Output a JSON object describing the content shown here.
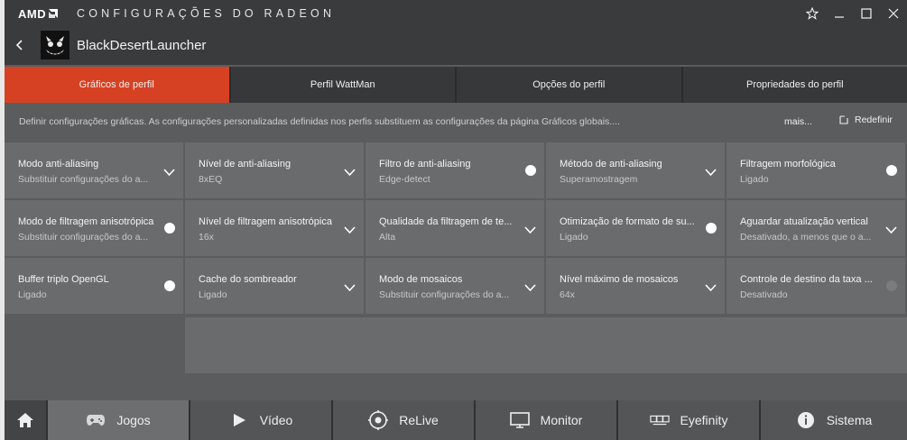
{
  "window": {
    "brand": "AMD",
    "title": "CONFIGURAÇÕES DO RADEON",
    "controls": [
      "star-icon",
      "minimize-icon",
      "maximize-icon",
      "close-icon"
    ]
  },
  "profile": {
    "back_icon": "back-chevron-icon",
    "game_name": "BlackDesertLauncher"
  },
  "tabs": [
    {
      "label": "Gráficos de perfil",
      "active": true
    },
    {
      "label": "Perfil WattMan",
      "active": false
    },
    {
      "label": "Opções do perfil",
      "active": false
    },
    {
      "label": "Propriedades do perfil",
      "active": false
    }
  ],
  "description": {
    "text": "Definir configurações gráficas. As configurações personalizadas definidas nos perfis substituem as configurações da página Gráficos globais....",
    "more_label": "mais...",
    "reset_label": "Redefinir"
  },
  "settings": [
    {
      "label": "Modo anti-aliasing",
      "value": "Substituir configurações do a...",
      "control": "dropdown"
    },
    {
      "label": "Nível de anti-aliasing",
      "value": "8xEQ",
      "control": "dropdown"
    },
    {
      "label": "Filtro de anti-aliasing",
      "value": "Edge-detect",
      "control": "toggle-on"
    },
    {
      "label": "Método de anti-aliasing",
      "value": "Superamostragem",
      "control": "dropdown"
    },
    {
      "label": "Filtragem morfológica",
      "value": "Ligado",
      "control": "toggle-on"
    },
    {
      "label": "Modo de filtragem anisotrópica",
      "value": "Substituir configurações do a...",
      "control": "toggle-on"
    },
    {
      "label": "Nível de filtragem anisotrópica",
      "value": "16x",
      "control": "dropdown"
    },
    {
      "label": "Qualidade da filtragem de te...",
      "value": "Alta",
      "control": "dropdown"
    },
    {
      "label": "Otimização de formato de su...",
      "value": "Ligado",
      "control": "toggle-on"
    },
    {
      "label": "Aguardar atualização vertical",
      "value": "Desativado, a menos que o a...",
      "control": "dropdown"
    },
    {
      "label": "Buffer triplo OpenGL",
      "value": "Ligado",
      "control": "toggle-on"
    },
    {
      "label": "Cache do sombreador",
      "value": "Ligado",
      "control": "dropdown"
    },
    {
      "label": "Modo de mosaicos",
      "value": "Substituir configurações do a...",
      "control": "dropdown"
    },
    {
      "label": "Nível máximo de mosaicos",
      "value": "64x",
      "control": "dropdown"
    },
    {
      "label": "Controle de destino da taxa ...",
      "value": "Desativado",
      "control": "toggle-off"
    }
  ],
  "bottom_nav": [
    {
      "label": "",
      "icon": "home-icon"
    },
    {
      "label": "Jogos",
      "icon": "gamepad-icon",
      "active": true
    },
    {
      "label": "Vídeo",
      "icon": "play-icon"
    },
    {
      "label": "ReLive",
      "icon": "relive-icon"
    },
    {
      "label": "Monitor",
      "icon": "monitor-icon"
    },
    {
      "label": "Eyefinity",
      "icon": "eyefinity-icon"
    },
    {
      "label": "Sistema",
      "icon": "info-icon"
    }
  ],
  "colors": {
    "accent": "#d64123",
    "titlebar": "#3a3b3d",
    "panel": "#6a6b6d",
    "background": "#5b5c5e",
    "nav_active": "#6d6e70"
  }
}
